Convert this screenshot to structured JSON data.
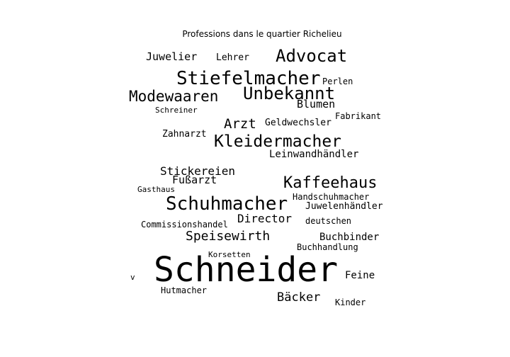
{
  "colors": {
    "text": "#000000",
    "background": "#ffffff"
  },
  "chart_data": {
    "type": "wordcloud",
    "title": "Professions dans le quartier Richelieu",
    "words": [
      {
        "text": "Schneider",
        "weight": 1.0
      },
      {
        "text": "Stiefelmacher",
        "weight": 0.55
      },
      {
        "text": "Schuhmacher",
        "weight": 0.55
      },
      {
        "text": "Kleidermacher",
        "weight": 0.5
      },
      {
        "text": "Unbekannt",
        "weight": 0.5
      },
      {
        "text": "Advocat",
        "weight": 0.5
      },
      {
        "text": "Kaffeehaus",
        "weight": 0.48
      },
      {
        "text": "Modewaaren",
        "weight": 0.46
      },
      {
        "text": "Arzt",
        "weight": 0.42
      },
      {
        "text": "Speisewirth",
        "weight": 0.4
      },
      {
        "text": "Bäcker",
        "weight": 0.38
      },
      {
        "text": "Stickereien",
        "weight": 0.36
      },
      {
        "text": "Director",
        "weight": 0.34
      },
      {
        "text": "Juwelier",
        "weight": 0.34
      },
      {
        "text": "Blumen",
        "weight": 0.34
      },
      {
        "text": "Fußarzt",
        "weight": 0.34
      },
      {
        "text": "Leinwandhändler",
        "weight": 0.33
      },
      {
        "text": "Buchbinder",
        "weight": 0.32
      },
      {
        "text": "Feine",
        "weight": 0.32
      },
      {
        "text": "Zahnarzt",
        "weight": 0.3
      },
      {
        "text": "Lehrer",
        "weight": 0.3
      },
      {
        "text": "Juwelenhändler",
        "weight": 0.3
      },
      {
        "text": "Geldwechsler",
        "weight": 0.3
      },
      {
        "text": "Perlen",
        "weight": 0.27
      },
      {
        "text": "Buchhandlung",
        "weight": 0.27
      },
      {
        "text": "deutschen",
        "weight": 0.27
      },
      {
        "text": "Commissionshandel",
        "weight": 0.26
      },
      {
        "text": "Hutmacher",
        "weight": 0.26
      },
      {
        "text": "Fabrikant",
        "weight": 0.26
      },
      {
        "text": "Handschuhmacher",
        "weight": 0.26
      },
      {
        "text": "Kinder",
        "weight": 0.26
      },
      {
        "text": "Gasthaus",
        "weight": 0.25
      },
      {
        "text": "Korsetten",
        "weight": 0.25
      },
      {
        "text": "Schreiner",
        "weight": 0.25
      },
      {
        "text": "v",
        "weight": 0.25
      }
    ]
  }
}
